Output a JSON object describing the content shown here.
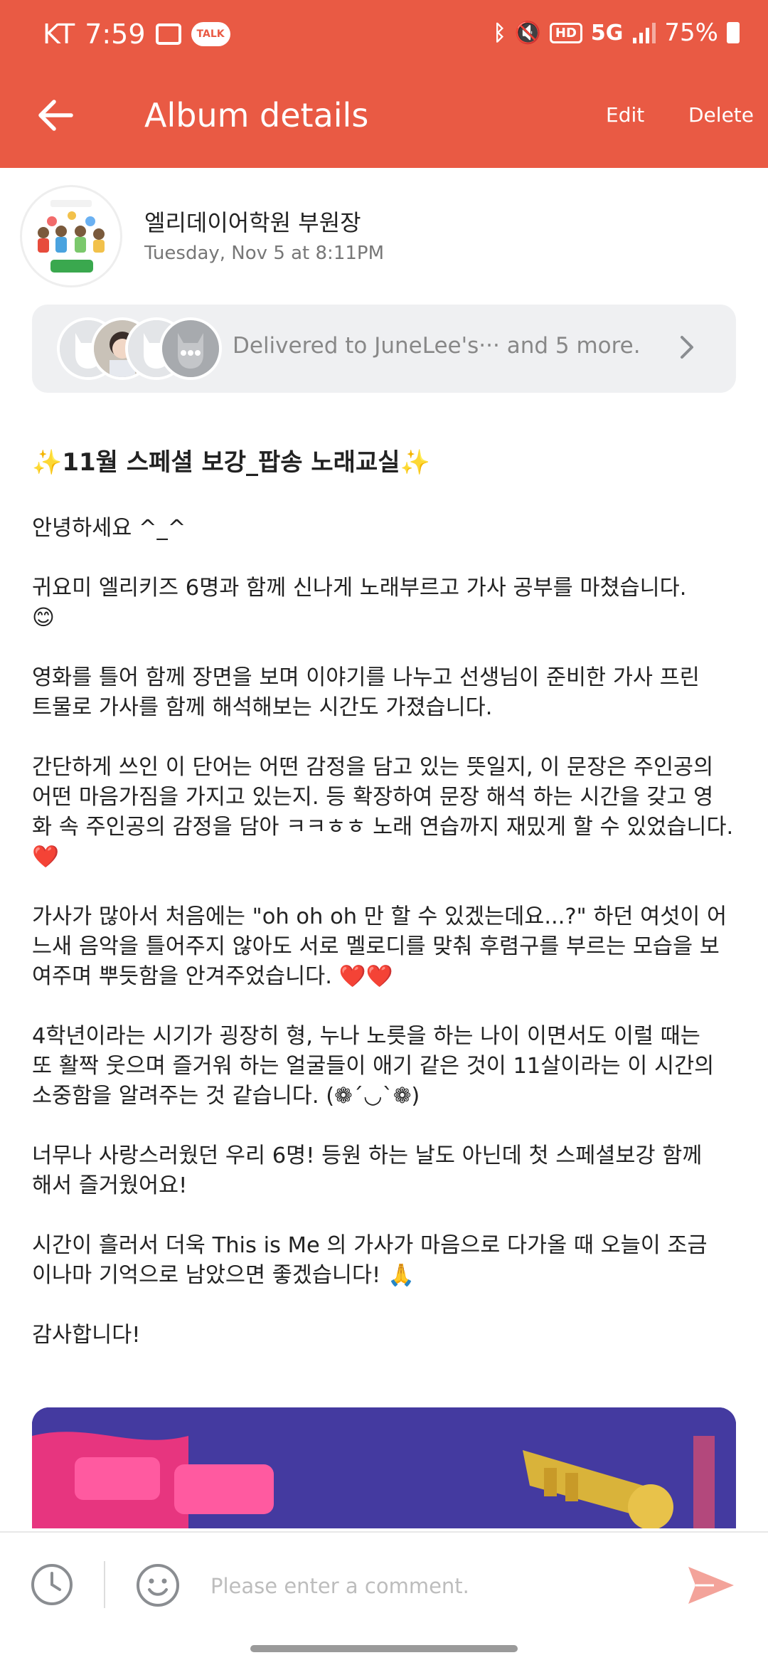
{
  "status_bar": {
    "carrier": "KT",
    "time": "7:59",
    "talk_badge": "TALK",
    "hd_label": "HD",
    "network_label": "5G",
    "battery": "75%"
  },
  "app_bar": {
    "title": "Album details",
    "edit_label": "Edit",
    "delete_label": "Delete"
  },
  "author": {
    "name": "엘리데이어학원 부원장",
    "date": "Tuesday, Nov 5 at 8:11PM"
  },
  "delivered": {
    "text": "Delivered to JuneLee's··· and 5 more."
  },
  "post": {
    "title": "✨11월 스페셜 보강_팝송 노래교실✨",
    "paragraphs": [
      "안녕하세요 ^_^",
      "귀요미 엘리키즈 6명과 함께 신나게 노래부르고 가사 공부를 마쳤습니다.\n😊",
      "영화를 틀어 함께 장면을 보며 이야기를 나누고 선생님이 준비한 가사 프린\n트물로 가사를 함께 해석해보는 시간도 가졌습니다.",
      "간단하게 쓰인 이 단어는 어떤 감정을 담고 있는 뜻일지, 이 문장은 주인공의\n어떤 마음가짐을 가지고 있는지. 등 확장하여 문장 해석 하는 시간을 갖고 영\n화 속 주인공의 감정을 담아 ㅋㅋㅎㅎ 노래 연습까지 재밌게 할 수 있었습니다.\n❤️",
      "가사가 많아서 처음에는 \"oh oh oh 만 할 수 있겠는데요...?\" 하던 여섯이 어\n느새 음악을 틀어주지 않아도 서로 멜로디를 맞춰 후렴구를 부르는 모습을 보\n여주며 뿌듯함을 안겨주었습니다. ❤️❤️",
      "4학년이라는 시기가 굉장히 형, 누나 노릇을 하는 나이 이면서도 이럴 때는\n또 활짝 웃으며 즐거워 하는 얼굴들이 애기 같은 것이 11살이라는 이 시간의\n소중함을 알려주는 것 같습니다. (❁´◡`❁)",
      "너무나 사랑스러웠던 우리 6명! 등원 하는 날도 아닌데 첫 스페셜보강 함께\n해서 즐거웠어요!",
      "시간이 흘러서 더욱 This is Me 의 가사가 마음으로 다가올 때 오늘이 조금\n이나마 기억으로 남았으면 좋겠습니다! 🙏",
      "감사합니다!"
    ]
  },
  "comment": {
    "placeholder": "Please enter a comment."
  },
  "colors": {
    "accent": "#E95A44",
    "delivered_bg": "#EFF0F2"
  }
}
